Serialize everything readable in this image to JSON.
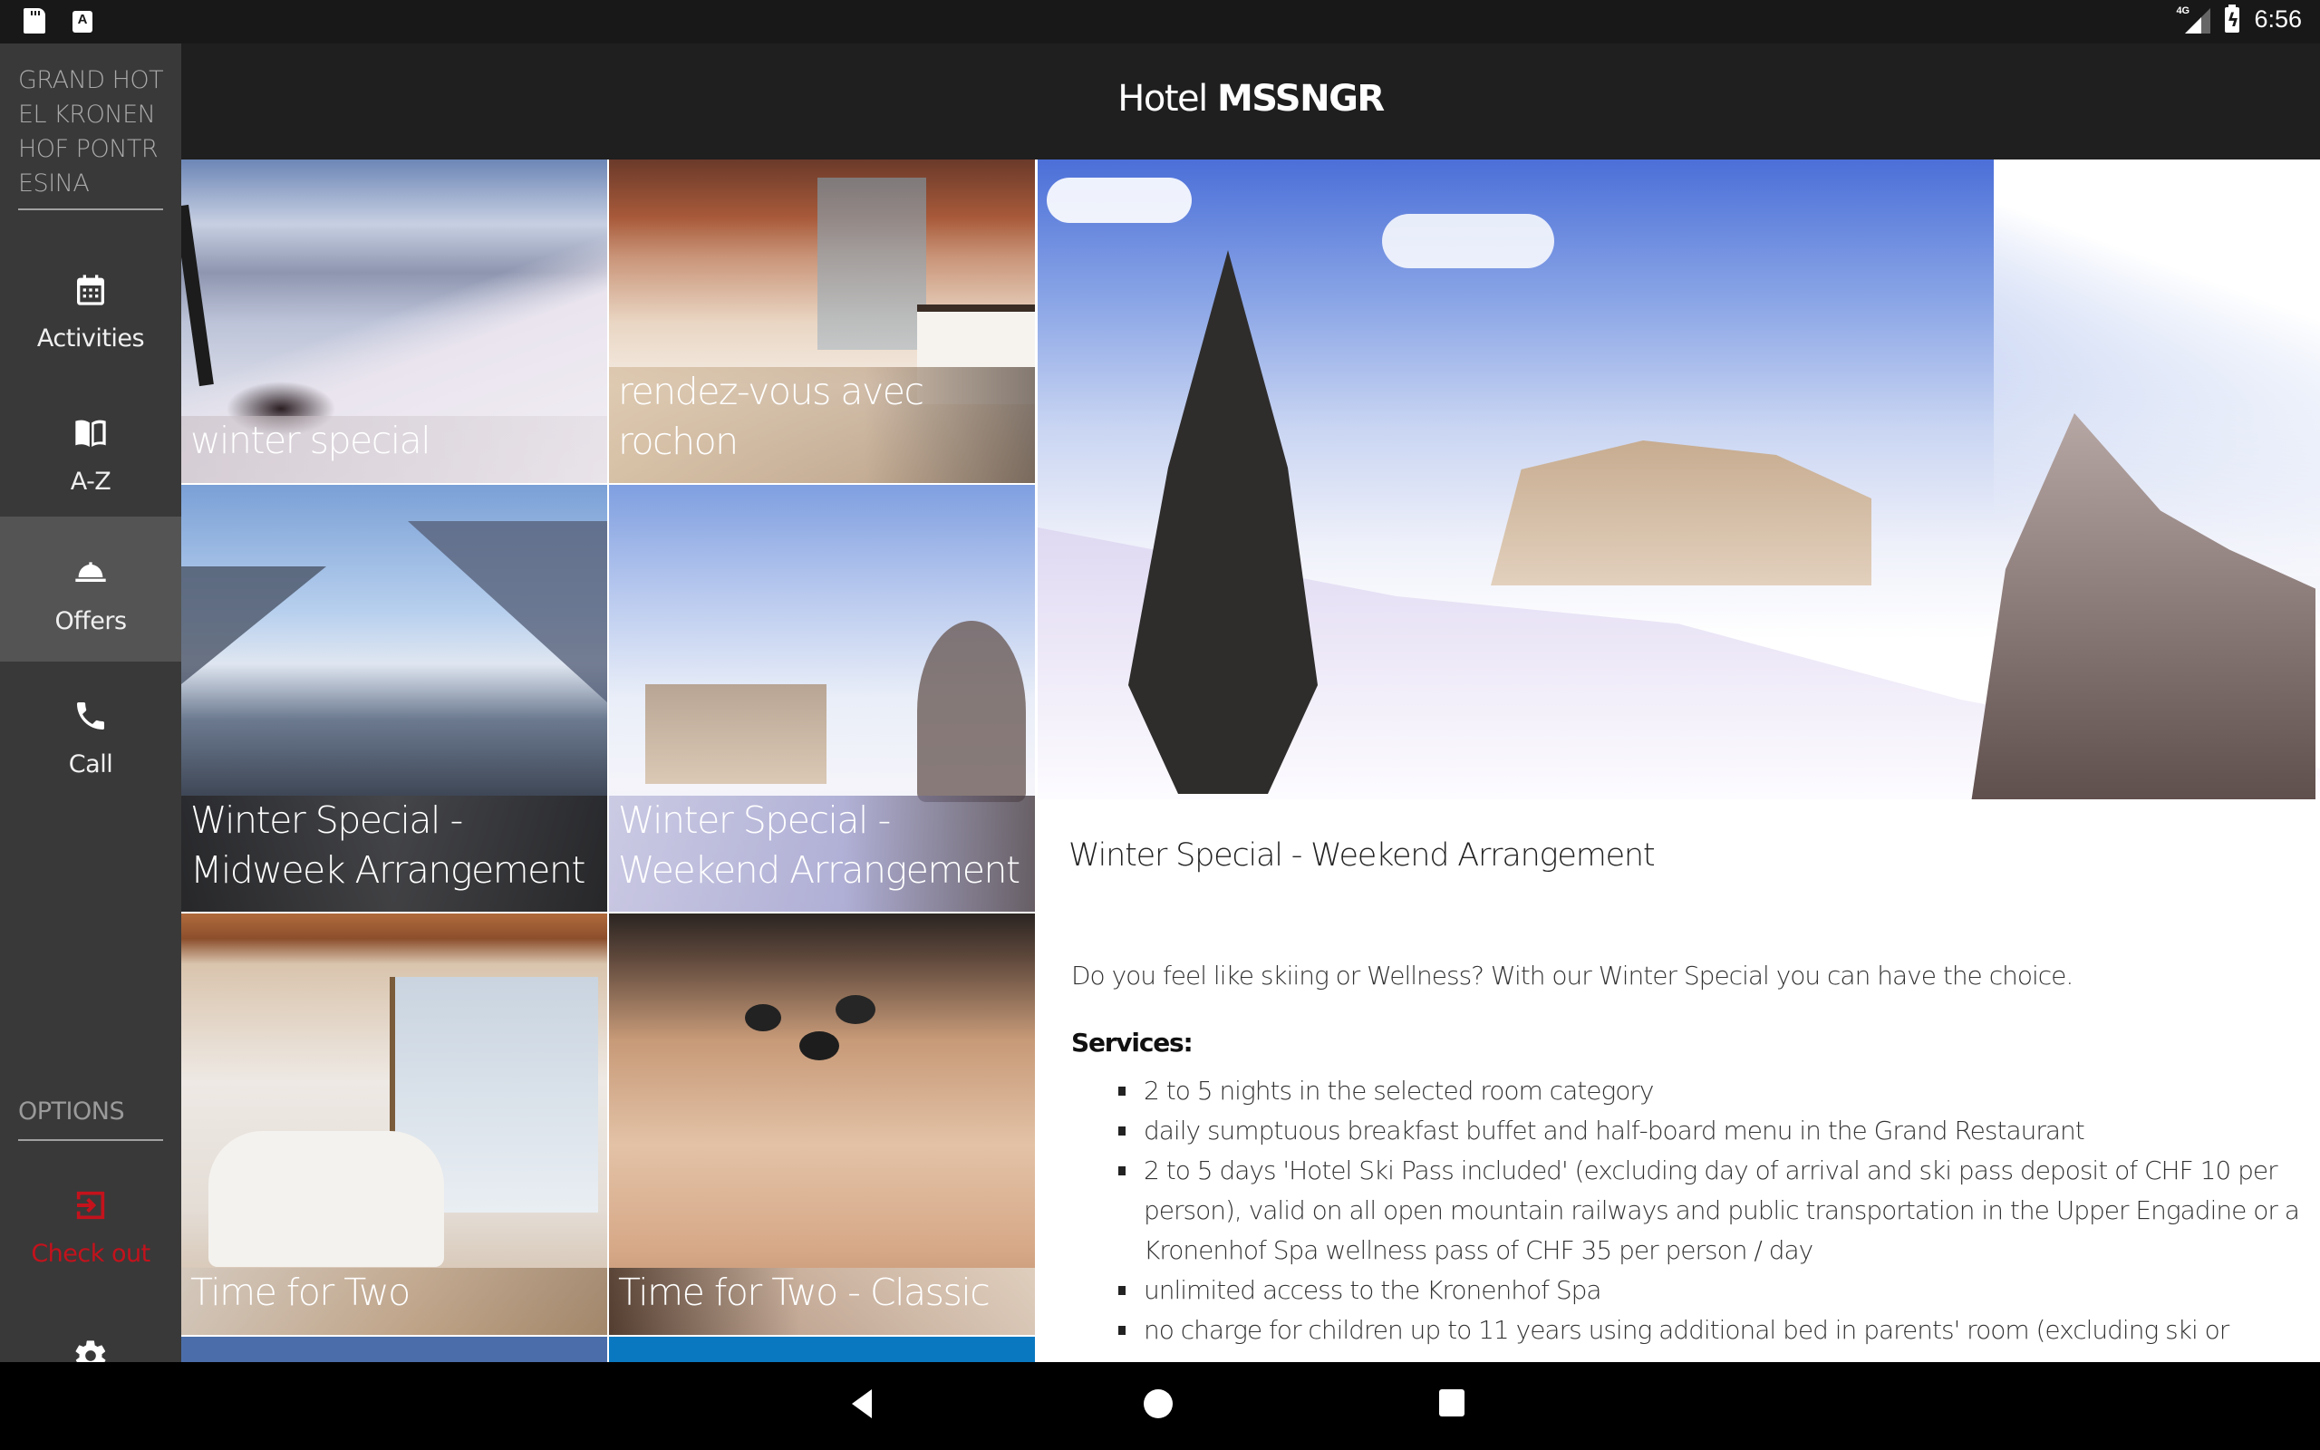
{
  "status_bar": {
    "left_icons": [
      "sd-card-icon",
      "a-notification-icon"
    ],
    "network": "4G",
    "battery": "charging",
    "time": "6:56"
  },
  "header": {
    "title_light": "Hotel",
    "title_bold": "MSSNGR"
  },
  "sidebar": {
    "hotel_name": "GRAND HOTEL KRONENHOF PONTRESINA",
    "items": [
      {
        "label": "Activities",
        "icon": "calendar-icon",
        "active": false
      },
      {
        "label": "A-Z",
        "icon": "book-icon",
        "active": false
      },
      {
        "label": "Offers",
        "icon": "bell-icon",
        "active": true
      },
      {
        "label": "Call",
        "icon": "phone-icon",
        "active": false
      }
    ],
    "options_label": "OPTIONS",
    "checkout": {
      "label": "Check out",
      "icon": "checkout-icon",
      "color": "#c4121c"
    },
    "settings_icon": "gear-icon"
  },
  "offers": [
    {
      "title": "winter special"
    },
    {
      "title": "rendez-vous avec rochon"
    },
    {
      "title": "Winter Special - Midweek Arrangement"
    },
    {
      "title": "Winter Special - Weekend Arrangement"
    },
    {
      "title": "Time for Two"
    },
    {
      "title": "Time for Two - Classic"
    }
  ],
  "detail": {
    "title": "Winter Special - Weekend Arrangement",
    "intro": "Do you feel like skiing or Wellness? With our Winter Special you can have the choice.",
    "services_heading": "Services:",
    "services": [
      "2 to 5 nights in the selected room category",
      "daily sumptuous breakfast buffet and half-board menu in the Grand Restaurant",
      "2 to 5 days 'Hotel Ski Pass included' (excluding day of arrival and ski pass deposit of CHF 10 per person), valid on all open mountain railways and public transportation in the Upper Engadine or a Kronenhof Spa wellness pass of CHF 35 per person / day",
      "unlimited access to the Kronenhof Spa",
      "no charge for children up to 11 years using additional bed in parents' room (excluding ski or"
    ]
  },
  "nav_bar": {
    "buttons": [
      "back",
      "home",
      "recents"
    ]
  },
  "colors": {
    "sidebar_bg": "#393939",
    "sidebar_active": "#545454",
    "header_bg": "#1f1f1f",
    "checkout_red": "#c4121c"
  }
}
